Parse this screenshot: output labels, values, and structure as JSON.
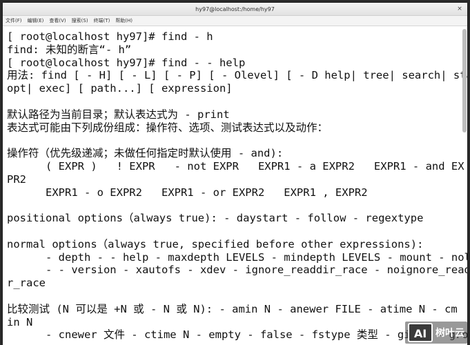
{
  "window": {
    "title": "hy97@localhost:/home/hy97",
    "close_glyph": "×"
  },
  "menu": [
    "文件(F)",
    "编辑(E)",
    "查看(V)",
    "搜索(S)",
    "终端(T)",
    "帮助(H)"
  ],
  "terminal_lines": [
    "[ root@localhost hy97]# find - h",
    "find: 未知的断言“- h”",
    "[ root@localhost hy97]# find - - help",
    "用法: find [ - H] [ - L] [ - P] [ - Olevel] [ - D help| tree| search| stat| rates|",
    "opt| exec] [ path...] [ expression]",
    "",
    "默认路径为当前目录；默认表达式为 - print",
    "表达式可能由下列成份组成：操作符、选项、测试表达式以及动作：",
    "",
    "操作符（优先级递减；未做任何指定时默认使用 - and):",
    "      ( EXPR )   ! EXPR   - not EXPR   EXPR1 - a EXPR2   EXPR1 - and EX",
    "PR2",
    "      EXPR1 - o EXPR2   EXPR1 - or EXPR2   EXPR1 , EXPR2",
    "",
    "positional options（always true): - daystart - follow - regextype",
    "",
    "normal options（always true, specified before other expressions):",
    "      - depth - - help - maxdepth LEVELS - mindepth LEVELS - mount - noleaf",
    "      - - version - xautofs - xdev - ignore_readdir_race - noignore_readdi",
    "r_race",
    "",
    "比较测试 (N 可以是 +N 或 - N 或 N): - amin N - anewer FILE - atime N - cm",
    "in N",
    "      - cnewer 文件 - ctime N - empty - false - fstype 类型 - gid N - group"
  ],
  "watermark": {
    "logo": "AI",
    "text": "树叶云"
  }
}
